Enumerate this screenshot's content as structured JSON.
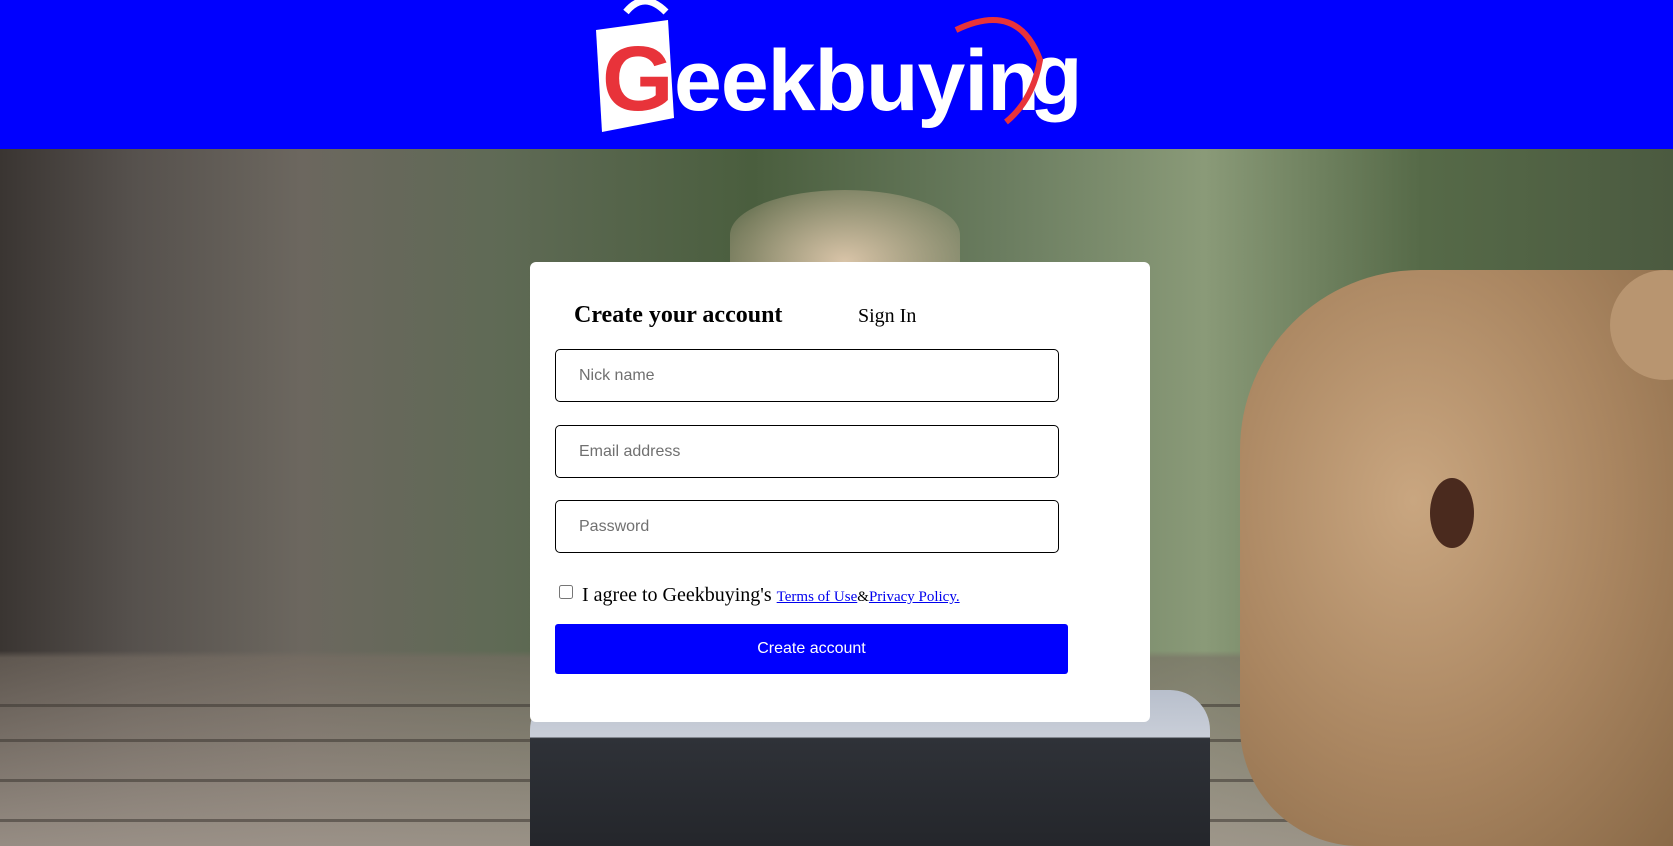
{
  "header": {
    "brand": "Geekbuying",
    "background_color": "#0000ff",
    "logo_red": "#e8333a"
  },
  "form": {
    "tabs": {
      "create_label": "Create your account",
      "signin_label": "Sign In"
    },
    "nickname": {
      "placeholder": "Nick name",
      "value": ""
    },
    "email": {
      "placeholder": "Email address",
      "value": ""
    },
    "password": {
      "placeholder": "Password",
      "value": ""
    },
    "agree": {
      "prefix": "I agree to Geekbuying's",
      "terms_link": "Terms of Use",
      "separator": "&",
      "privacy_link": "Privacy Policy.",
      "checked": false
    },
    "submit_label": "Create account",
    "accent_color": "#0000ff"
  }
}
